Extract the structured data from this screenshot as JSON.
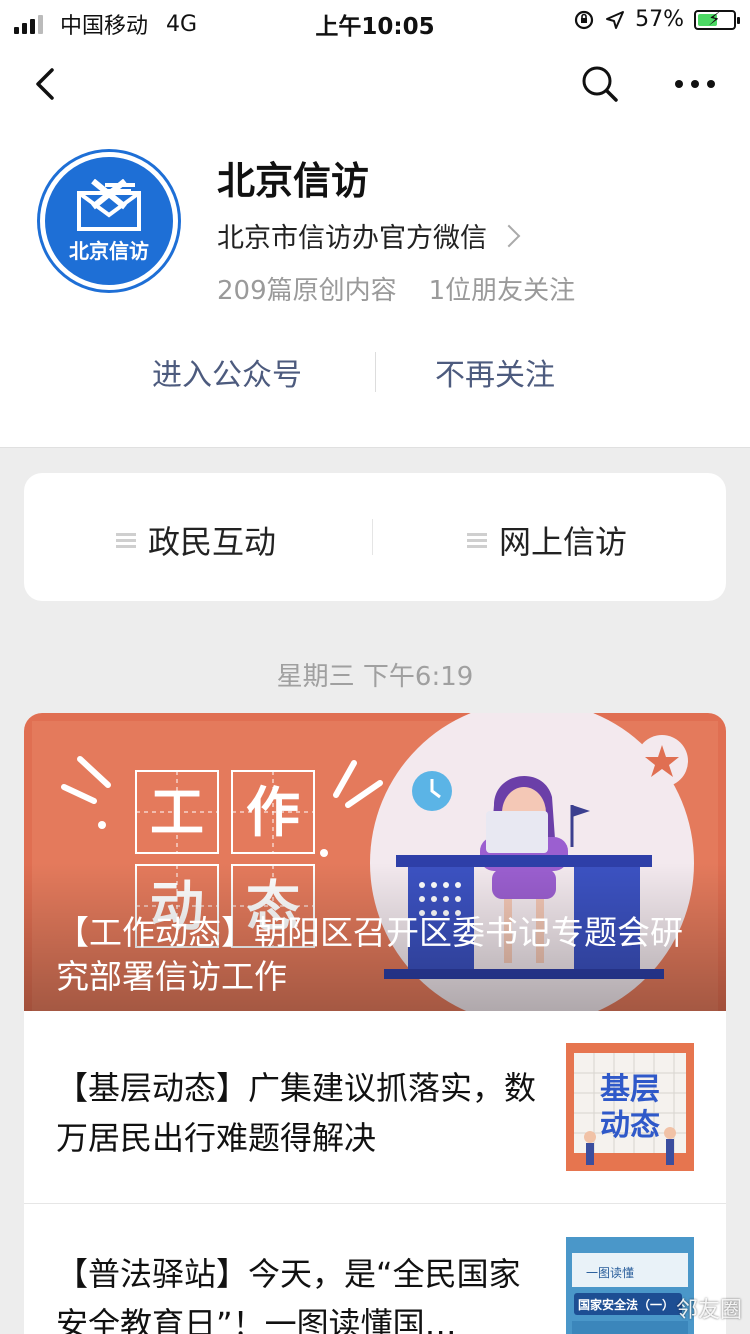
{
  "status_bar": {
    "carrier": "中国移动",
    "network": "4G",
    "time": "上午10:05",
    "battery": "57%",
    "battery_level": 0.57
  },
  "nav": {
    "back_icon": "chevron-left-icon",
    "search_icon": "search-icon",
    "more_icon": "more-icon"
  },
  "profile": {
    "avatar_text": "北京信访",
    "name": "北京信访",
    "description": "北京市信访办官方微信",
    "original_count": "209篇原创内容",
    "friends_following": "1位朋友关注",
    "enter_label": "进入公众号",
    "unfollow_label": "不再关注"
  },
  "menu": {
    "items": [
      {
        "label": "政民互动"
      },
      {
        "label": "网上信访"
      }
    ]
  },
  "timestamp": "星期三 下午6:19",
  "articles": {
    "cover": {
      "image_text": [
        "工",
        "作",
        "动",
        "态"
      ],
      "title": "【工作动态】朝阳区召开区委书记专题会研究部署信访工作"
    },
    "items": [
      {
        "title": "【基层动态】广集建议抓落实，数万居民出行难题得解决",
        "thumb_text": "基层动态"
      },
      {
        "title": "【普法驿站】今天，是“全民国家安全教育日”！一图读懂国…",
        "thumb_text": "国家安全法（一）",
        "thumb_header": "一图读懂"
      }
    ]
  },
  "watermark": "邻友圈",
  "colors": {
    "accent": "#1e6fd6",
    "action_text": "#4d5b7e",
    "cover_bg": "#e06f52"
  }
}
